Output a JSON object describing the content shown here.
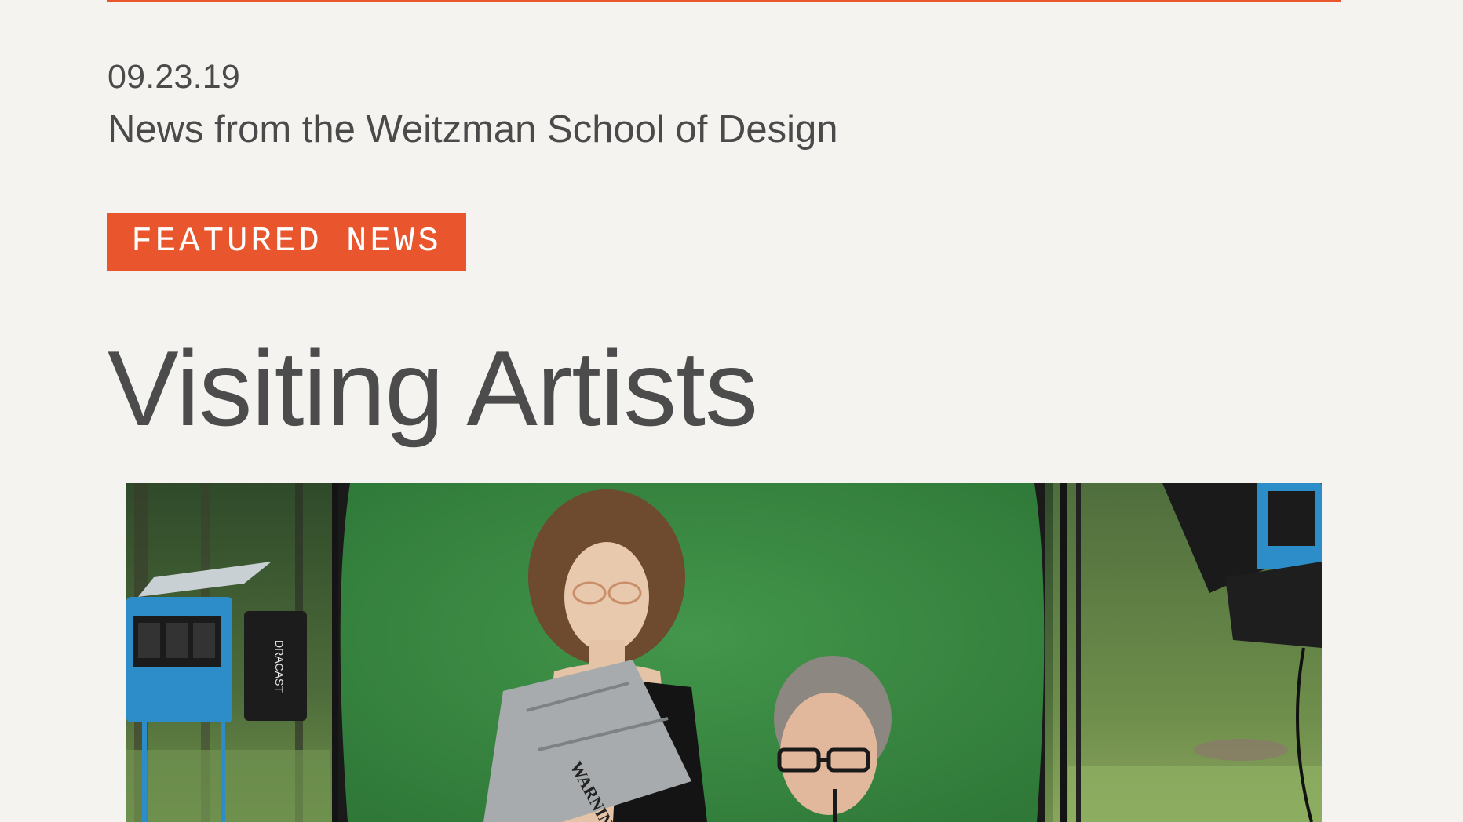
{
  "header": {
    "date": "09.23.19",
    "subtitle": "News from the Weitzman School of Design"
  },
  "section": {
    "badge_label": "FEATURED NEWS"
  },
  "article": {
    "headline": "Visiting Artists"
  },
  "photo": {
    "light_brand": "DRACAST",
    "prop_text": "WARNING!"
  },
  "colors": {
    "accent": "#e9552c",
    "background": "#f4f3ef",
    "text": "#4a4a4a",
    "greenscreen": "#3e8a45"
  }
}
